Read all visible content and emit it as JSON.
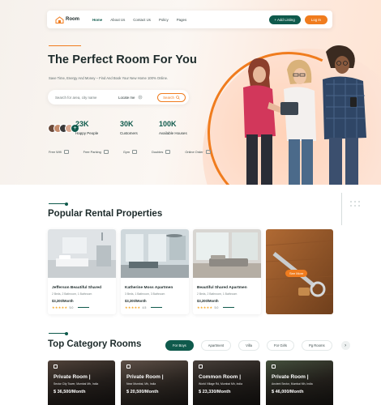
{
  "brand": {
    "name": "Room"
  },
  "nav": {
    "links": [
      "Home",
      "About Us",
      "Contact Us",
      "Policy",
      "Pages"
    ],
    "add_listing": "+ Add Listing",
    "login": "Log In"
  },
  "hero": {
    "title": "The Perfect Room For You",
    "subtitle": "Save Time, Energy And Money – Find And Book Your New Home 100% Online.",
    "search_placeholder": "Search for area, city name",
    "locate": "Locate me",
    "search_button": "Search",
    "stats": [
      {
        "value": "23K",
        "label": "Happy People"
      },
      {
        "value": "30K",
        "label": "Customers"
      },
      {
        "value": "100K",
        "label": "Available Houses"
      }
    ],
    "amenities": [
      "Free Wifi",
      "Free Parking",
      "Gym",
      "Doubles",
      "Online Order"
    ]
  },
  "popular": {
    "title": "Popular Rental Properties",
    "cards": [
      {
        "name": "Jefferson Beautiful Shared",
        "meta": "2 Beds, 2 Bathroom, 1 Bathroom",
        "price": "$3,200/Month",
        "rating": "5.0"
      },
      {
        "name": "Katherine Moss Apartmen",
        "meta": "3 Beds, 1 Bathroom, 3 Bathroom",
        "price": "$3,200/Month",
        "rating": "4.5"
      },
      {
        "name": "Beautiful Shared Apartmen",
        "meta": "2 Beds, 2 Bathroom, 1 Bathroom",
        "price": "$3,200/Month",
        "rating": "5.0"
      }
    ],
    "promo_button": "See More"
  },
  "category": {
    "title": "Top Category Rooms",
    "tabs": [
      "For Boys",
      "Apartment",
      "Villa",
      "For Girls",
      "Pg Rooms"
    ],
    "next": "›",
    "rooms": [
      {
        "type": "Private Room |",
        "location": "Sector City Tower, Mumbai Mh, India",
        "price": "$ 36,500/Month"
      },
      {
        "type": "Private Room |",
        "location": "Near Mumbai, Mh, India",
        "price": "$ 20,500/Month"
      },
      {
        "type": "Common Room |",
        "location": "World Village Rd, Mumbai Mh, India",
        "price": "$ 23,330/Month"
      },
      {
        "type": "Private Room |",
        "location": "Ancient Sector, Mumbai Mh, India",
        "price": "$ 46,000/Month"
      }
    ]
  },
  "colors": {
    "primary": "#0f5a4c",
    "accent": "#f07c1e"
  }
}
